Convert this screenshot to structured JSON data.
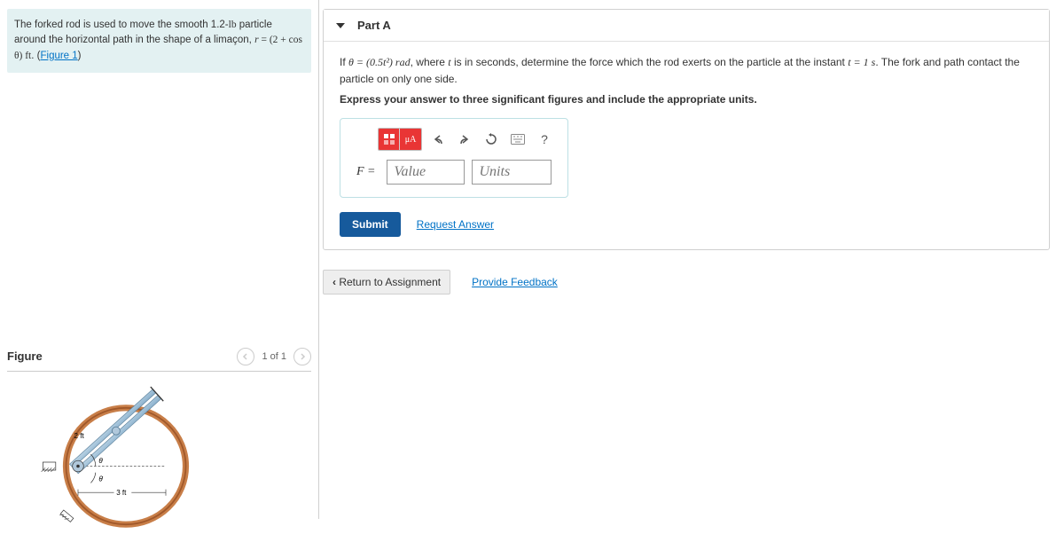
{
  "problem": {
    "text_prefix": "The forked rod is used to move the smooth 1.2-",
    "unit_lb": "lb",
    "text_mid": " particle around the horizontal path in the shape of a limaçon, ",
    "eq_r": "r",
    "eq_eq": " = ",
    "eq_rhs": "(2 + cos θ) ft",
    "text_suffix": ". (",
    "figure_link": "Figure 1",
    "text_close": ")"
  },
  "figure": {
    "title": "Figure",
    "page": "1 of 1",
    "dim1": "2 ft",
    "dim2": "3 ft",
    "theta1": "θ",
    "theta2": "θ̇"
  },
  "part": {
    "title": "Part A",
    "q_prefix": "If ",
    "q_theta": "θ = (0.5t²) rad",
    "q_mid": ", where ",
    "q_t": "t",
    "q_mid2": " is in seconds, determine the force which the rod exerts on the particle at the instant ",
    "q_t1": "t = 1 s",
    "q_suffix": ". The fork and path contact the particle on only one side.",
    "instruction": "Express your answer to three significant figures and include the appropriate units.",
    "f_label": "F =",
    "value_ph": "Value",
    "units_ph": "Units",
    "submit": "Submit",
    "request": "Request Answer",
    "help": "?"
  },
  "footer": {
    "return": "Return to Assignment",
    "feedback": "Provide Feedback"
  }
}
